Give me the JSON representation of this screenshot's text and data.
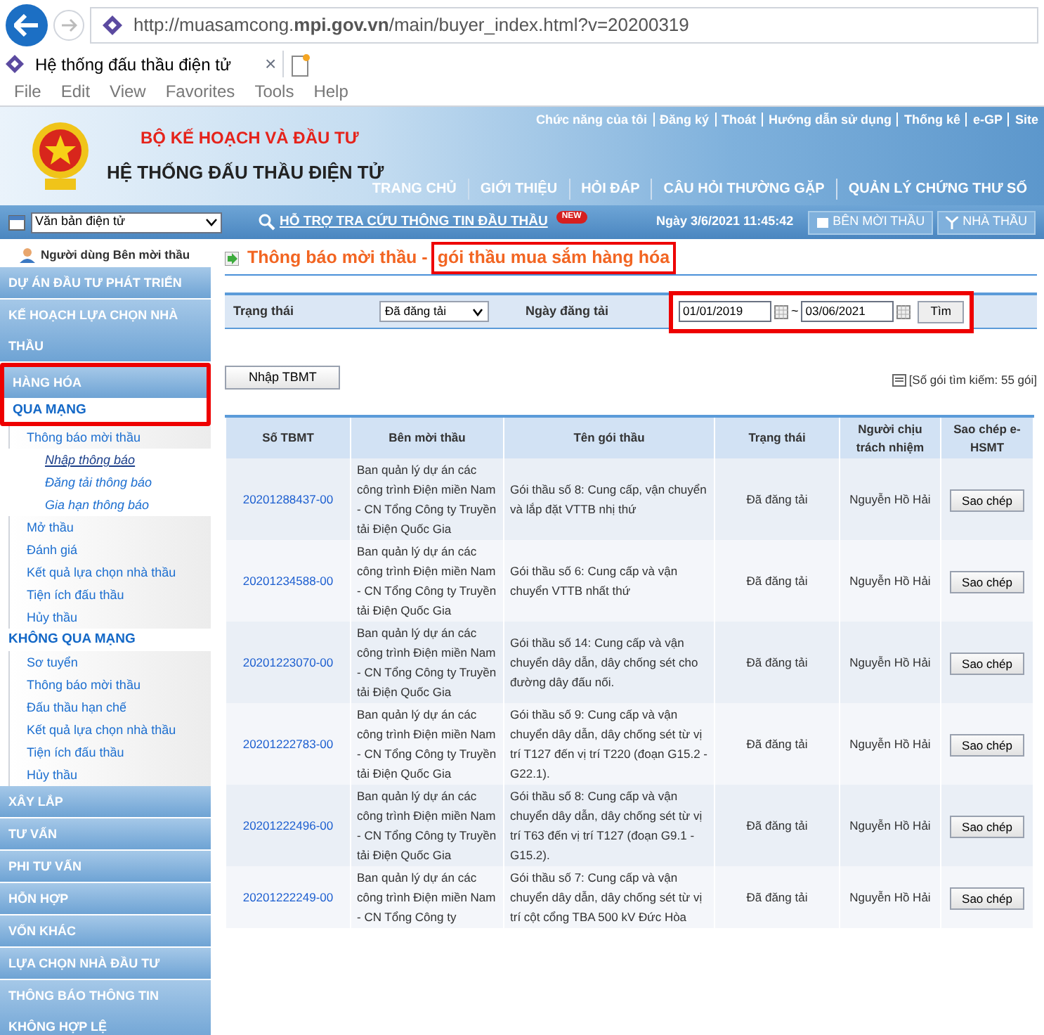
{
  "browser": {
    "url": "http://muasamcong.**mpi.gov.vn**/main/buyer_index.html?v=20200319",
    "tab_title": "Hệ thống đấu thầu điện tử",
    "tab_close": "×",
    "menu": [
      "File",
      "Edit",
      "View",
      "Favorites",
      "Tools",
      "Help"
    ]
  },
  "header": {
    "ministry": "BỘ KẾ HOẠCH VÀ ĐẦU TƯ",
    "system": "HỆ THỐNG ĐẤU THẦU ĐIỆN TỬ",
    "top_links": [
      "Chức năng của tôi",
      "Đăng ký",
      "Thoát",
      "Hướng dẫn sử dụng",
      "Thống kê",
      "e-GP",
      "Site"
    ],
    "nav": [
      "TRANG CHỦ",
      "GIỚI THIỆU",
      "HỎI ĐÁP",
      "CÂU HỎI THƯỜNG GẶP",
      "QUẢN LÝ CHỨNG THƯ SỐ"
    ]
  },
  "toolbar": {
    "select": "Văn bản điện tử",
    "help_link": "HỖ TRỢ TRA CỨU THÔNG TIN ĐẦU THẦU",
    "badge": "NEW",
    "datetime": "Ngày 3/6/2021 11:45:42",
    "buttons": [
      "BÊN MỜI THẦU",
      "NHÀ THẦU"
    ]
  },
  "sidebar": {
    "user": "Người dùng Bên mời thầu",
    "entries": [
      {
        "kind": "section",
        "label": "DỰ ÁN ĐẦU TƯ PHÁT TRIỂN",
        "highlighted": false
      },
      {
        "kind": "section",
        "label": "KẾ HOẠCH LỰA CHỌN NHÀ THẦU",
        "highlighted": false
      },
      {
        "kind": "section",
        "label": "HÀNG HÓA",
        "highlighted": true
      },
      {
        "kind": "group",
        "label": "QUA MẠNG",
        "highlighted": true
      },
      {
        "kind": "item",
        "label": "Thông báo mời thầu",
        "highlighted": false,
        "children": [
          {
            "label": "Nhập thông báo",
            "selected": true
          },
          {
            "label": "Đăng tải thông báo",
            "selected": false
          },
          {
            "label": "Gia hạn thông báo",
            "selected": false
          }
        ]
      },
      {
        "kind": "item",
        "label": "Mở thầu",
        "highlighted": false
      },
      {
        "kind": "item",
        "label": "Đánh giá",
        "highlighted": false
      },
      {
        "kind": "item",
        "label": "Kết quả lựa chọn nhà thầu",
        "highlighted": false
      },
      {
        "kind": "item",
        "label": "Tiện ích đấu thầu",
        "highlighted": false
      },
      {
        "kind": "item",
        "label": "Hủy thầu",
        "highlighted": false
      },
      {
        "kind": "group",
        "label": "KHÔNG QUA MẠNG",
        "highlighted": false
      },
      {
        "kind": "item",
        "label": "Sơ tuyển",
        "highlighted": false
      },
      {
        "kind": "item",
        "label": "Thông báo mời thầu",
        "highlighted": false
      },
      {
        "kind": "item",
        "label": "Đấu thầu hạn chế",
        "highlighted": false
      },
      {
        "kind": "item",
        "label": "Kết quả lựa chọn nhà thầu",
        "highlighted": false
      },
      {
        "kind": "item",
        "label": "Tiện ích đấu thầu",
        "highlighted": false
      },
      {
        "kind": "item",
        "label": "Hủy thầu",
        "highlighted": false
      },
      {
        "kind": "section",
        "label": "XÂY LẮP",
        "highlighted": false
      },
      {
        "kind": "section",
        "label": "TƯ VẤN",
        "highlighted": false
      },
      {
        "kind": "section",
        "label": "PHI TƯ VẤN",
        "highlighted": false
      },
      {
        "kind": "section",
        "label": "HỖN HỢP",
        "highlighted": false
      },
      {
        "kind": "section",
        "label": "VỐN KHÁC",
        "highlighted": false
      },
      {
        "kind": "section",
        "label": "LỰA CHỌN NHÀ ĐẦU TƯ",
        "highlighted": false
      },
      {
        "kind": "section",
        "label": "THÔNG BÁO THÔNG TIN KHÔNG HỢP LỆ",
        "highlighted": false
      }
    ]
  },
  "page_title": {
    "text": "Thông báo mời thầu -",
    "highlighted_text": "gói thầu mua sắm hàng hóa"
  },
  "filter": {
    "status_label": "Trạng thái",
    "status_value": "Đã đăng tải",
    "date_label": "Ngày đăng tải",
    "date_from": "01/01/2019",
    "separator": "~",
    "date_to": "03/06/2021",
    "search_button": "Tìm",
    "date_highlighted": true
  },
  "new_button": "Nhập TBMT",
  "result_count": "[Số gói tìm kiếm: 55 gói]",
  "table": {
    "columns": [
      "Số TBMT",
      "Bên mời thầu",
      "Tên gói thầu",
      "Trạng thái",
      "Người chịu trách nhiệm",
      "Sao chép e-HSMT"
    ],
    "rows": [
      {
        "code": "20201288437-00",
        "inviter": "Ban quản lý dự án các công trình Điện miền Nam - CN Tổng Công ty Truyền tải Điện Quốc Gia",
        "package": "Gói thầu số 8: Cung cấp, vận chuyển và lắp đặt VTTB nhị thứ",
        "status": "Đã đăng tải",
        "person": "Nguyễn Hồ Hải",
        "action": "Sao chép"
      },
      {
        "code": "20201234588-00",
        "inviter": "Ban quản lý dự án các công trình Điện miền Nam - CN Tổng Công ty Truyền tải Điện Quốc Gia",
        "package": "Gói thầu số 6: Cung cấp và vận chuyển VTTB nhất thứ",
        "status": "Đã đăng tải",
        "person": "Nguyễn Hồ Hải",
        "action": "Sao chép"
      },
      {
        "code": "20201223070-00",
        "inviter": "Ban quản lý dự án các công trình Điện miền Nam - CN Tổng Công ty Truyền tải Điện Quốc Gia",
        "package": "Gói thầu số 14: Cung cấp và vận chuyển dây dẫn, dây chống sét cho đường dây đấu nối.",
        "status": "Đã đăng tải",
        "person": "Nguyễn Hồ Hải",
        "action": "Sao chép"
      },
      {
        "code": "20201222783-00",
        "inviter": "Ban quản lý dự án các công trình Điện miền Nam - CN Tổng Công ty Truyền tải Điện Quốc Gia",
        "package": "Gói thầu số 9: Cung cấp và vận chuyển dây dẫn, dây chống sét từ vị trí T127 đến vị trí T220 (đoạn G15.2 - G22.1).",
        "status": "Đã đăng tải",
        "person": "Nguyễn Hồ Hải",
        "action": "Sao chép"
      },
      {
        "code": "20201222496-00",
        "inviter": "Ban quản lý dự án các công trình Điện miền Nam - CN Tổng Công ty Truyền tải Điện Quốc Gia",
        "package": "Gói thầu số 8: Cung cấp và vận chuyển dây dẫn, dây chống sét từ vị trí T63 đến vị trí T127 (đoạn G9.1 - G15.2).",
        "status": "Đã đăng tải",
        "person": "Nguyễn Hồ Hải",
        "action": "Sao chép"
      },
      {
        "code": "20201222249-00",
        "inviter": "Ban quản lý dự án các công trình Điện miền Nam - CN Tổng Công ty",
        "package": "Gói thầu số 7: Cung cấp và vận chuyển dây dẫn, dây chống sét từ vị trí cột cổng TBA 500 kV Đức Hòa",
        "status": "Đã đăng tải",
        "person": "Nguyễn Hồ Hải",
        "action": "Sao chép"
      }
    ]
  }
}
